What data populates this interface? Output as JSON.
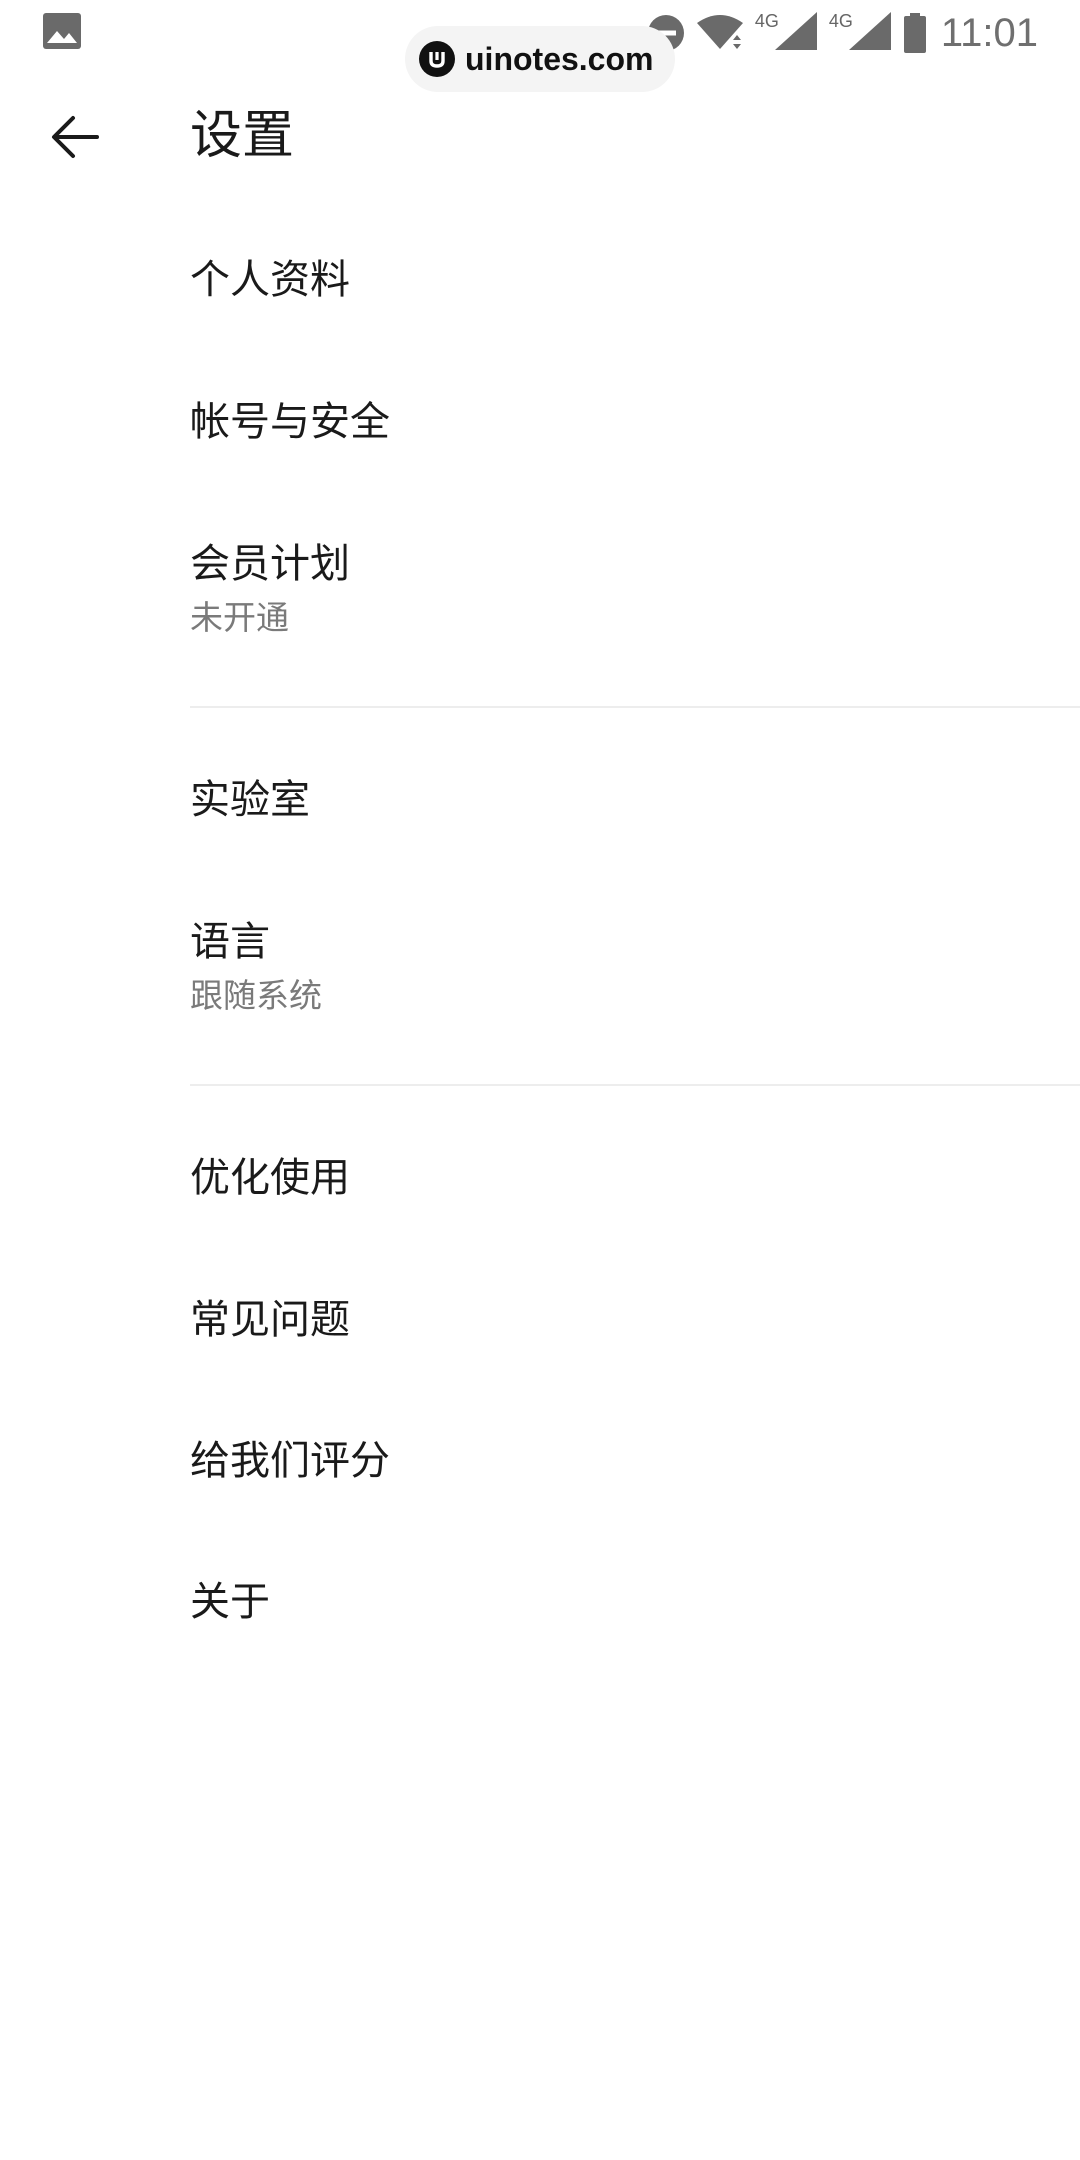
{
  "status_bar": {
    "time": "11:01",
    "network_1": "4G",
    "network_2": "4G",
    "icons": [
      "image-icon",
      "do-not-disturb-icon",
      "wifi-icon",
      "signal-icon",
      "signal-icon",
      "battery-icon"
    ]
  },
  "watermark": {
    "text": "uinotes.com"
  },
  "header": {
    "title": "设置",
    "back_icon": "arrow-left-icon"
  },
  "settings": {
    "profile": {
      "label": "个人资料"
    },
    "account_security": {
      "label": "帐号与安全"
    },
    "membership": {
      "label": "会员计划",
      "sub": "未开通"
    },
    "lab": {
      "label": "实验室"
    },
    "language": {
      "label": "语言",
      "sub": "跟随系统"
    },
    "optimize": {
      "label": "优化使用"
    },
    "faq": {
      "label": "常见问题"
    },
    "rate_us": {
      "label": "给我们评分"
    },
    "about": {
      "label": "关于"
    }
  },
  "colors": {
    "background": "#ffffff",
    "text_primary": "#1a1a1a",
    "text_secondary": "#7a7a7a",
    "divider": "#ededed"
  }
}
